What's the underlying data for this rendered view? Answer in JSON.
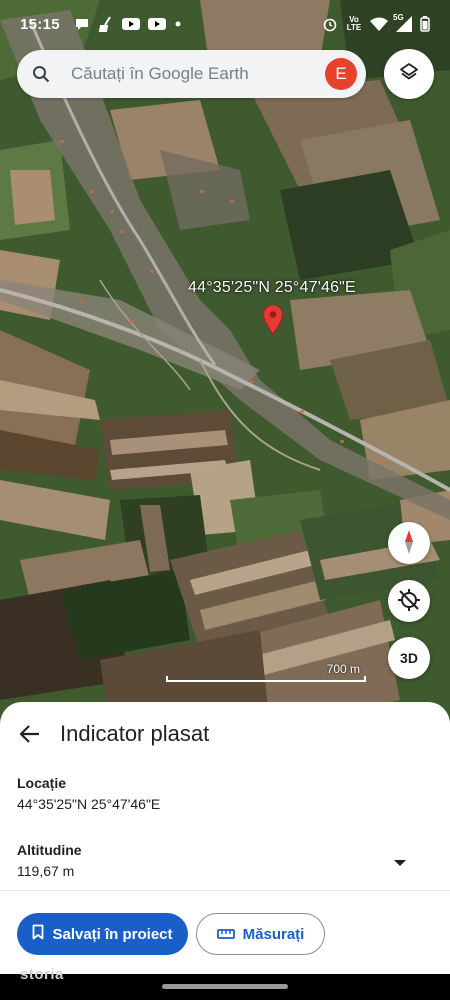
{
  "status_bar": {
    "time": "15:15",
    "icons_left": [
      "chat-icon",
      "broom-icon",
      "youtube-icon",
      "youtube-icon",
      "dot-icon"
    ],
    "icons_right": [
      "alarm-icon",
      "volte-icon",
      "wifi-icon",
      "signal-5g-icon",
      "battery-icon"
    ],
    "volte_text": "Vo LTE",
    "net_text": "5G"
  },
  "search": {
    "placeholder": "Căutați în Google Earth",
    "avatar_letter": "E",
    "avatar_color": "#e8412e"
  },
  "map": {
    "pin_label": "44°35'25\"N 25°47'46\"E",
    "pin_color": "#e53935",
    "scale_label": "700 m",
    "compass_button": "compass-icon",
    "location_button": "gps-off-icon",
    "view_3d_label": "3D"
  },
  "sheet": {
    "title": "Indicator plasat",
    "location_label": "Locație",
    "location_value": "44°35'25\"N 25°47'46\"E",
    "altitude_label": "Altitudine",
    "altitude_value": "119,67 m",
    "save_button": "Salvați în proiect",
    "measure_button": "Măsurați",
    "accent_color": "#1a5fc7"
  },
  "watermark": "storia"
}
